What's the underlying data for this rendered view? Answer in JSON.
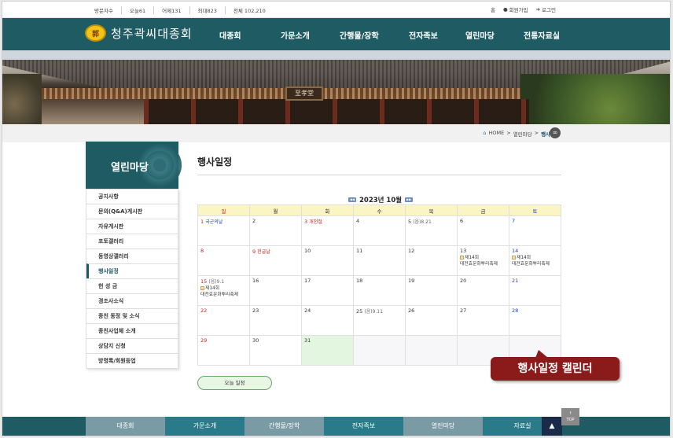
{
  "topbar": {
    "stats": [
      "방문자수",
      "오늘61",
      "어제131",
      "최대823",
      "전체 102,210"
    ],
    "links": [
      {
        "icon": "home-icon",
        "label": "홈"
      },
      {
        "icon": "user-add-icon",
        "label": "회원가입"
      },
      {
        "icon": "login-icon",
        "label": "로그인"
      }
    ]
  },
  "header": {
    "logo_text": "청주곽씨대종회",
    "logo_emblem": "郭",
    "nav": [
      "대종회",
      "가문소개",
      "간행물/장학",
      "전자족보",
      "열린마당",
      "전통자료실"
    ]
  },
  "banner": {
    "sign_text": "至孝堂"
  },
  "breadcrumb": {
    "home": "HOME",
    "sep": ">",
    "parent": "열린마당",
    "current": "행사일정"
  },
  "sidebar": {
    "title": "열린마당",
    "items": [
      "공지사항",
      "문의(Q&A)게시판",
      "자유게시판",
      "포토갤러리",
      "동영상갤러리",
      "행사일정",
      "헌 성 금",
      "경조사소식",
      "종친 동정 및 소식",
      "종친사업체 소개",
      "상담지 신청",
      "방명록/회원등업"
    ],
    "active_index": 5
  },
  "content": {
    "page_title": "행사일정",
    "month_label": "2023년 10월",
    "weekdays": [
      "일",
      "월",
      "화",
      "수",
      "목",
      "금",
      "토"
    ],
    "today_button": "오늘 일정",
    "callout": "행사일정 캘린더"
  },
  "calendar": {
    "weeks": [
      [
        {
          "day": "1",
          "note": "국군의날",
          "note_color": "blue"
        },
        {
          "day": "2"
        },
        {
          "day": "3",
          "note": "개천절",
          "note_color": "red",
          "red_day": true
        },
        {
          "day": "4"
        },
        {
          "day": "5",
          "note": "(음)8.21",
          "note_color": "gray"
        },
        {
          "day": "6"
        },
        {
          "day": "7"
        }
      ],
      [
        {
          "day": "8"
        },
        {
          "day": "9",
          "note": "한글날",
          "note_color": "red",
          "red_day": true
        },
        {
          "day": "10"
        },
        {
          "day": "11"
        },
        {
          "day": "12"
        },
        {
          "day": "13",
          "events": [
            "제14회",
            "대전효문화뿌리축제"
          ]
        },
        {
          "day": "14",
          "events": [
            "제14회",
            "대전효문화뿌리축제"
          ]
        }
      ],
      [
        {
          "day": "15",
          "note": "(음)9.1",
          "note_color": "gray",
          "events": [
            "제14회",
            "대전효문화뿌리축제"
          ]
        },
        {
          "day": "16"
        },
        {
          "day": "17"
        },
        {
          "day": "18"
        },
        {
          "day": "19"
        },
        {
          "day": "20"
        },
        {
          "day": "21"
        }
      ],
      [
        {
          "day": "22"
        },
        {
          "day": "23"
        },
        {
          "day": "24"
        },
        {
          "day": "25",
          "note": "(음)9.11",
          "note_color": "gray"
        },
        {
          "day": "26"
        },
        {
          "day": "27"
        },
        {
          "day": "28"
        }
      ],
      [
        {
          "day": "29"
        },
        {
          "day": "30"
        },
        {
          "day": "31",
          "today": true
        },
        {
          "empty": true
        },
        {
          "empty": true
        },
        {
          "empty": true
        },
        {
          "empty": true
        }
      ]
    ]
  },
  "footer": {
    "nav": [
      {
        "label": "대종회",
        "color": "#7a9aa4"
      },
      {
        "label": "가문소개",
        "color": "#2a7b8a"
      },
      {
        "label": "간행물/장학",
        "color": "#7a9aa4"
      },
      {
        "label": "전자족보",
        "color": "#2a7b8a"
      },
      {
        "label": "열린마당",
        "color": "#7a9aa4"
      },
      {
        "label": "자료실",
        "color": "#2a7b8a"
      }
    ],
    "top_label": "TOP"
  },
  "colors": {
    "primary": "#1f5b63",
    "calendar_header_bg": "#fbf4c4",
    "today_bg": "#e3f6e0",
    "callout_bg": "#8b1a1a",
    "sunday": "#d21c1c",
    "saturday": "#1a3fb8"
  }
}
